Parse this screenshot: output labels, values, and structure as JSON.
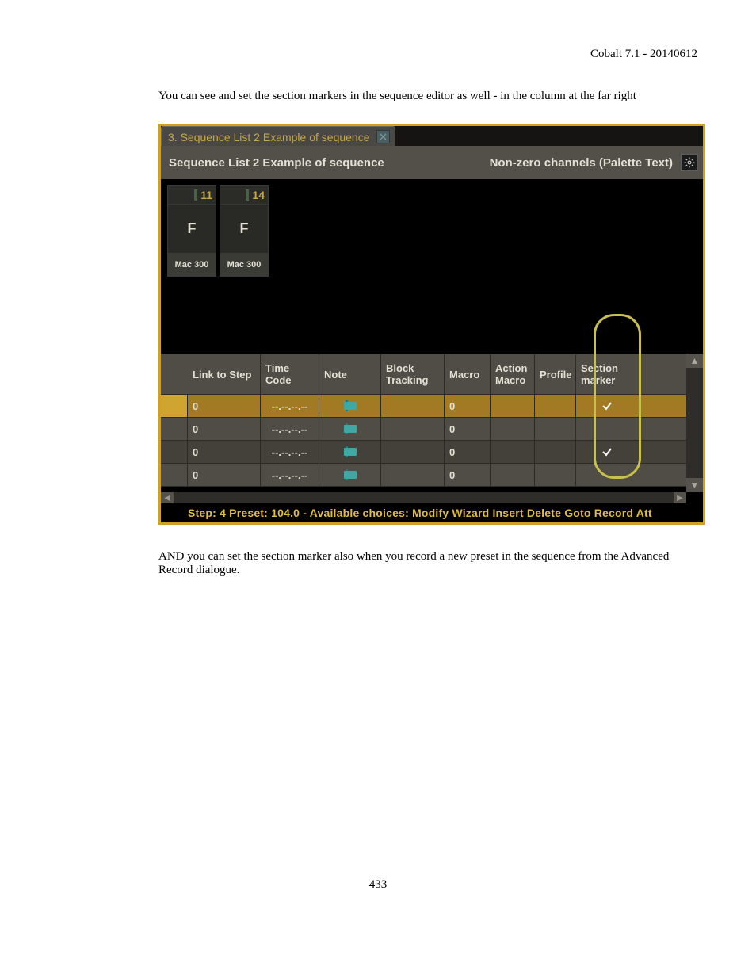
{
  "header_right": "Cobalt 7.1 - 20140612",
  "para1": "You can see and set the section markers in the sequence editor as well - in the column at the far right",
  "para2": "AND you can set the section marker also when you record a new preset in the sequence from the Advanced Record dialogue.",
  "page_number": "433",
  "shot": {
    "tab_title": "3. Sequence List 2 Example of sequence",
    "header_left": "Sequence List 2 Example of sequence",
    "header_right": "Non-zero channels (Palette Text)",
    "fixtures": [
      {
        "num": "11",
        "level": "F",
        "label": "Mac 300"
      },
      {
        "num": "14",
        "level": "F",
        "label": "Mac 300"
      }
    ],
    "columns": {
      "link_to_step": "Link to Step",
      "time_code": "Time Code",
      "note": "Note",
      "block_tracking": "Block Tracking",
      "macro": "Macro",
      "action_macro": "Action Macro",
      "profile": "Profile",
      "section_marker": "Section marker"
    },
    "rows": [
      {
        "selected": true,
        "shade": "dark",
        "link": "0",
        "timecode": "--.--.--.--",
        "note_icon": true,
        "macro": "0",
        "section_checked": true
      },
      {
        "selected": false,
        "shade": "light",
        "link": "0",
        "timecode": "--.--.--.--",
        "note_icon": true,
        "macro": "0",
        "section_checked": false
      },
      {
        "selected": false,
        "shade": "dark",
        "link": "0",
        "timecode": "--.--.--.--",
        "note_icon": true,
        "macro": "0",
        "section_checked": true
      },
      {
        "selected": false,
        "shade": "light",
        "link": "0",
        "timecode": "--.--.--.--",
        "note_icon": true,
        "macro": "0",
        "section_checked": false
      }
    ],
    "status": "Step: 4 Preset: 104.0 - Available choices: Modify Wizard Insert Delete Goto Record Att"
  }
}
